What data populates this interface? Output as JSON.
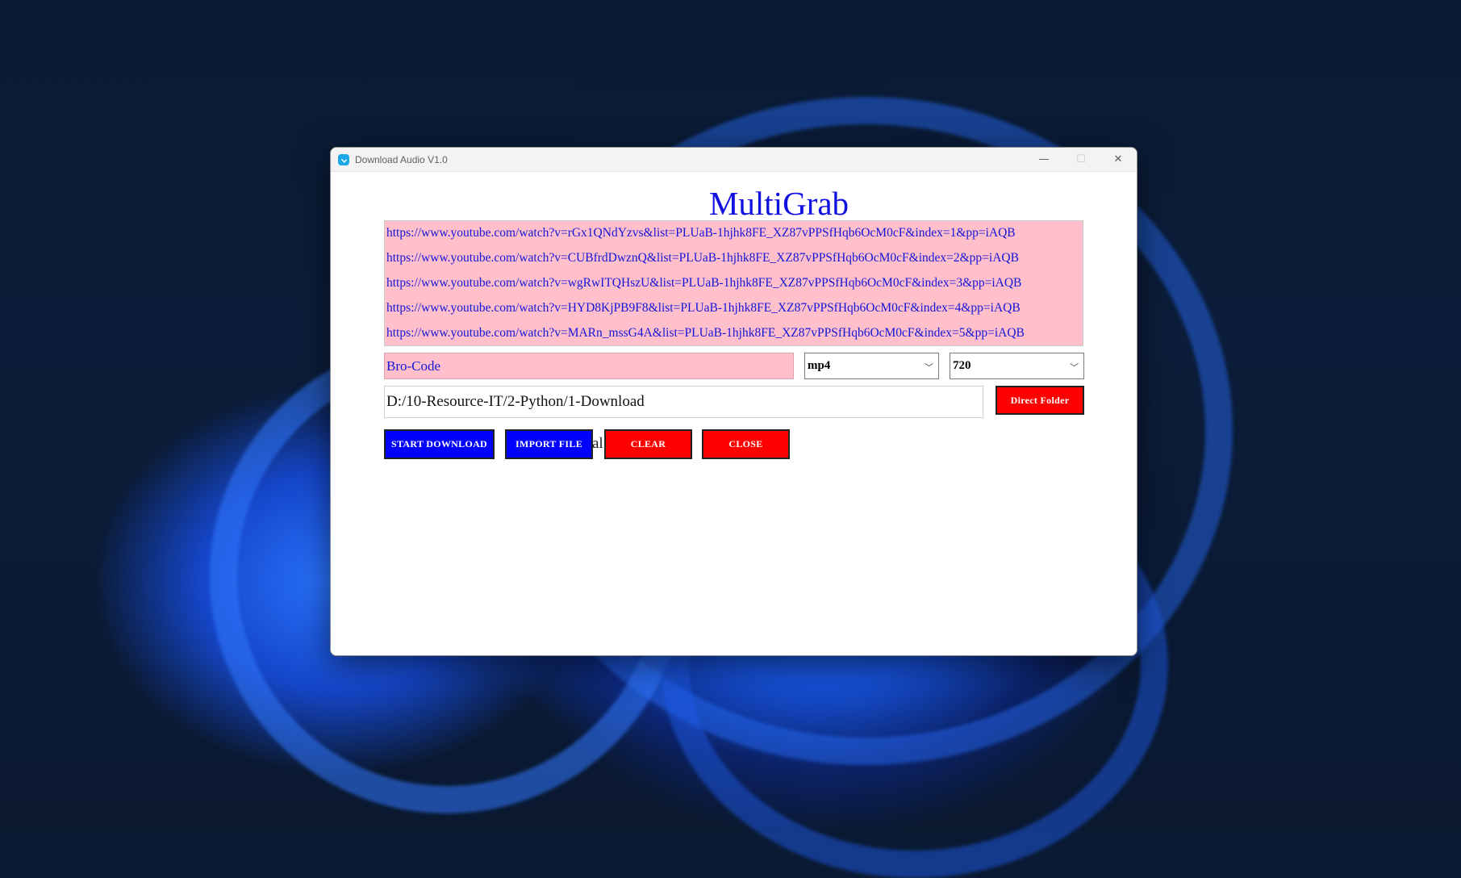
{
  "window": {
    "title": "Download Audio V1.0",
    "controls": {
      "minimize": "—",
      "maximize": "☐",
      "close": "✕"
    }
  },
  "app": {
    "heading": "MultiGrab",
    "urls": [
      "https://www.youtube.com/watch?v=rGx1QNdYzvs&list=PLUaB-1hjhk8FE_XZ87vPPSfHqb6OcM0cF&index=1&pp=iAQB",
      "https://www.youtube.com/watch?v=CUBfrdDwznQ&list=PLUaB-1hjhk8FE_XZ87vPPSfHqb6OcM0cF&index=2&pp=iAQB",
      "https://www.youtube.com/watch?v=wgRwITQHszU&list=PLUaB-1hjhk8FE_XZ87vPPSfHqb6OcM0cF&index=3&pp=iAQB",
      "https://www.youtube.com/watch?v=HYD8KjPB9F8&list=PLUaB-1hjhk8FE_XZ87vPPSfHqb6OcM0cF&index=4&pp=iAQB",
      "https://www.youtube.com/watch?v=MARn_mssG4A&list=PLUaB-1hjhk8FE_XZ87vPPSfHqb6OcM0cF&index=5&pp=iAQB"
    ],
    "folder_name": "Bro-Code",
    "format": "mp4",
    "quality": "720",
    "path": "D:/10-Resource-IT/2-Python/1-Download",
    "buttons": {
      "direct_folder": "Direct Folder",
      "start_download": "START DOWNLOAD",
      "import_file": "IMPORT FILE",
      "clear": "CLEAR",
      "close": "CLOSE"
    },
    "hidden_label_fragment": "al"
  },
  "colors": {
    "heading": "#1010e0",
    "url_bg": "#ffc0cb",
    "primary_button": "#0000ff",
    "danger_button": "#ff0000"
  },
  "icons": {
    "app": "download-icon",
    "dropdown": "chevron-down-icon"
  }
}
